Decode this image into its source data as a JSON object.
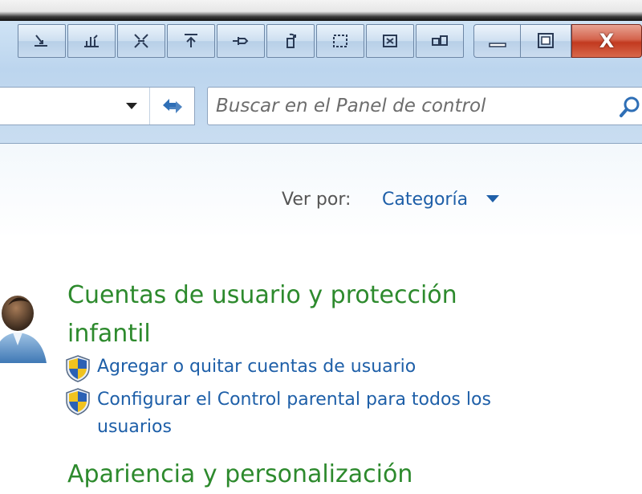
{
  "toolbar": {
    "buttons": [
      {
        "icon": "dock-bottom-left-icon"
      },
      {
        "icon": "bar-chart-icon"
      },
      {
        "icon": "fit-window-icon"
      },
      {
        "icon": "pin-top-icon"
      },
      {
        "icon": "pin-icon"
      },
      {
        "icon": "refresh-copy-icon"
      },
      {
        "icon": "screen-frame-icon"
      },
      {
        "icon": "screen-grid-icon"
      },
      {
        "icon": "tiles-icon"
      }
    ]
  },
  "window_controls": {
    "minimize_label": "Minimize",
    "maximize_label": "Maximize",
    "close_glyph": "X"
  },
  "address": {
    "value": ""
  },
  "search": {
    "placeholder": "Buscar en el Panel de control"
  },
  "view_by": {
    "label": "Ver por:",
    "value": "Categoría"
  },
  "categories": [
    {
      "title_line1": "Cuentas de usuario y protección",
      "title_line2": "infantil",
      "tasks": [
        {
          "label": "Agregar o quitar cuentas de usuario"
        },
        {
          "label": "Configurar el Control parental para todos los usuarios"
        }
      ]
    },
    {
      "title_line1": "Apariencia y personalización"
    }
  ],
  "colors": {
    "category_green": "#2d8a2d",
    "link_blue": "#1e5fa8",
    "close_red": "#c2391f"
  }
}
